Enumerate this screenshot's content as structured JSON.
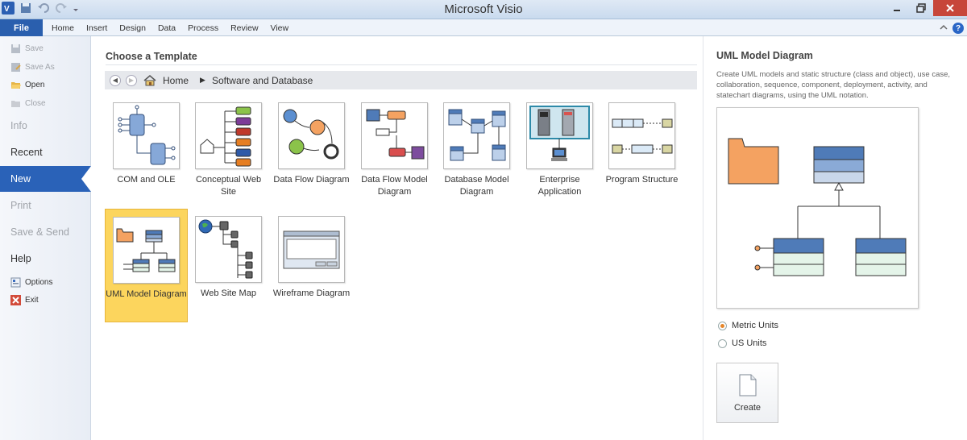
{
  "window": {
    "title": "Microsoft Visio"
  },
  "ribbon": {
    "file_tab": "File",
    "tabs": [
      "Home",
      "Insert",
      "Design",
      "Data",
      "Process",
      "Review",
      "View"
    ]
  },
  "backstage": {
    "small_items": [
      {
        "label": "Save",
        "icon": "save-icon",
        "enabled": false
      },
      {
        "label": "Save As",
        "icon": "save-as-icon",
        "enabled": false
      },
      {
        "label": "Open",
        "icon": "open-folder-icon",
        "enabled": true
      },
      {
        "label": "Close",
        "icon": "close-file-icon",
        "enabled": false
      }
    ],
    "big_items": [
      {
        "label": "Info",
        "enabled": false
      },
      {
        "label": "Recent",
        "enabled": true
      },
      {
        "label": "New",
        "selected": true
      },
      {
        "label": "Print",
        "enabled": false
      },
      {
        "label": "Save & Send",
        "enabled": false
      },
      {
        "label": "Help",
        "enabled": true
      }
    ],
    "options_label": "Options",
    "exit_label": "Exit"
  },
  "templates_panel": {
    "heading": "Choose a Template",
    "breadcrumb": {
      "home": "Home",
      "current": "Software and Database"
    },
    "templates": [
      {
        "label": "COM and OLE",
        "selected": false
      },
      {
        "label": "Conceptual Web Site",
        "selected": false
      },
      {
        "label": "Data Flow Diagram",
        "selected": false
      },
      {
        "label": "Data Flow Model Diagram",
        "selected": false
      },
      {
        "label": "Database Model Diagram",
        "selected": false
      },
      {
        "label": "Enterprise Application",
        "selected": false
      },
      {
        "label": "Program Structure",
        "selected": false
      },
      {
        "label": "UML Model Diagram",
        "selected": true
      },
      {
        "label": "Web Site Map",
        "selected": false
      },
      {
        "label": "Wireframe Diagram",
        "selected": false
      }
    ]
  },
  "details": {
    "title": "UML Model Diagram",
    "description": "Create UML models and static structure (class and object), use case, collaboration, sequence, component, deployment, activity, and statechart diagrams, using the UML notation.",
    "units": [
      {
        "label": "Metric Units",
        "checked": true
      },
      {
        "label": "US Units",
        "checked": false
      }
    ],
    "create_label": "Create"
  },
  "colors": {
    "accent": "#2a62b8",
    "selection": "#fcd55d",
    "close": "#c7463a"
  }
}
